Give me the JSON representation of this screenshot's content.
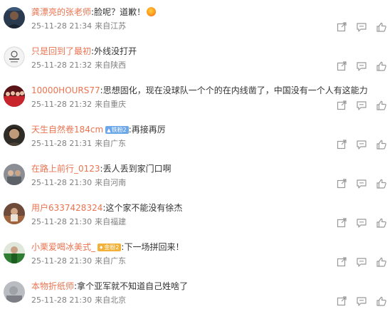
{
  "comments": [
    {
      "user": "龚漂亮的张老师",
      "text": "脸呢？道歉！",
      "emoji": "angry-emoji",
      "time": "25-11-28 21:34",
      "location": "来自江苏",
      "avatar": "avatar-dark-photo"
    },
    {
      "user": "只是回到了最初",
      "text": "外线没打开",
      "time": "25-11-28 21:32",
      "location": "来自陕西",
      "avatar": "avatar-logo-white"
    },
    {
      "user": "10000HOURS77",
      "text": "思想固化，现在没球队一个个的在内线凿了，中国没有一个人有这能力",
      "time": "25-11-28 21:32",
      "location": "来自重庆",
      "avatar": "avatar-red-team"
    },
    {
      "user": "天生自然卷184cm",
      "badge": "铁粉2",
      "badge_icon": "▲",
      "badge_color": "#6da8ea",
      "text": "再接再厉",
      "time": "25-11-28 21:31",
      "location": "来自广东",
      "avatar": "avatar-portrait"
    },
    {
      "user": "在路上前行_0123",
      "text": "丢人丢到家门口啊",
      "time": "25-11-28 21:30",
      "location": "来自河南",
      "avatar": "avatar-group-photo"
    },
    {
      "user": "用户6337428324",
      "text": "这个家不能没有徐杰",
      "time": "25-11-28 21:30",
      "location": "来自福建",
      "avatar": "avatar-court-photo"
    },
    {
      "user": "小栗爱喝冰美式_",
      "badge": "金粉2",
      "badge_icon": "♦",
      "badge_color": "#f2b23a",
      "text": "下一场拼回来！",
      "time": "25-11-28 21:30",
      "location": "来自广东",
      "avatar": "avatar-green-player"
    },
    {
      "user": "本物折纸师",
      "text": "拿个亚军就不知道自己姓啥了",
      "time": "25-11-28 21:30",
      "location": "来自北京",
      "avatar": "avatar-grey-photo"
    }
  ],
  "action_icons": [
    "share-icon",
    "comment-icon",
    "like-icon"
  ]
}
